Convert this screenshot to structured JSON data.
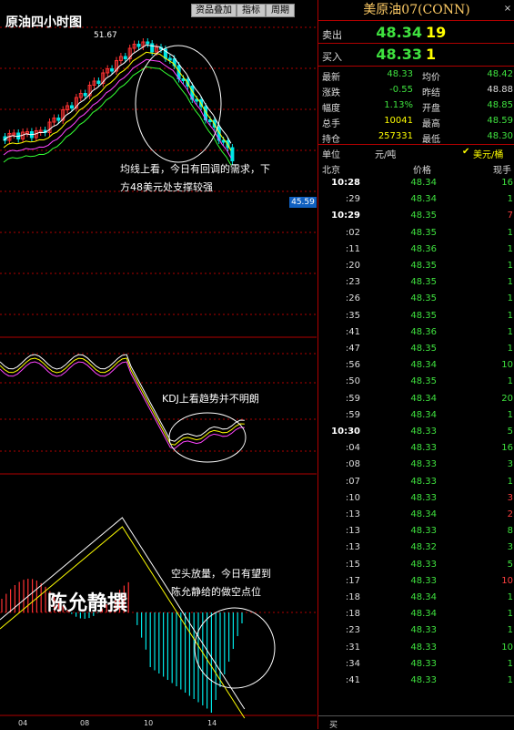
{
  "chart": {
    "title": "原油四小时图",
    "buttons": [
      "资品叠加",
      "指标",
      "周期"
    ],
    "high_label": "51.67",
    "price_tag": "45.59",
    "annot_ma_1": "均线上看，今日有回调的需求，下",
    "annot_ma_2": "方48美元处支撑较强",
    "annot_kdj": "KDJ上看趋势并不明朗",
    "annot_macd_1": "空头放量，今日有望到",
    "annot_macd_2": "陈允静给的做空点位",
    "watermark": "陈允静撰",
    "x_labels": [
      "04",
      "08",
      "10",
      "14"
    ],
    "colors": {
      "up": "#ff3333",
      "down": "#00e6e6",
      "ma1": "#ffffff",
      "ma2": "#ffff00",
      "ma3": "#ff44ff",
      "ma4": "#33ff33"
    }
  },
  "quote": {
    "title": "美原油07(CONN)",
    "close": "×",
    "ask_label": "卖出",
    "ask_price": "48.34",
    "ask_vol": "19",
    "bid_label": "买入",
    "bid_price": "48.33",
    "bid_vol": "1",
    "stats": [
      {
        "l1": "最新",
        "v1": "48.33",
        "c1": "green",
        "l2": "均价",
        "v2": "48.42",
        "c2": "green"
      },
      {
        "l1": "涨跌",
        "v1": "-0.55",
        "c1": "green",
        "l2": "昨结",
        "v2": "48.88",
        "c2": "white"
      },
      {
        "l1": "幅度",
        "v1": "1.13%",
        "c1": "green",
        "l2": "开盘",
        "v2": "48.85",
        "c2": "green"
      },
      {
        "l1": "总手",
        "v1": "10041",
        "c1": "yellow",
        "l2": "最高",
        "v2": "48.59",
        "c2": "green"
      },
      {
        "l1": "持仓",
        "v1": "257331",
        "c1": "yellow",
        "l2": "最低",
        "v2": "48.30",
        "c2": "green"
      }
    ],
    "unit_label": "单位",
    "unit_value": "元/吨",
    "unit_check": "美元/桶",
    "col_time": "北京",
    "col_price": "价格",
    "col_vol": "现手",
    "ticks": [
      {
        "t": "10:28",
        "p": "48.34",
        "v": "16",
        "vc": "green"
      },
      {
        "t": ":29",
        "p": "48.34",
        "v": "1",
        "vc": "green"
      },
      {
        "t": "10:29",
        "p": "48.35",
        "v": "7",
        "vc": "red"
      },
      {
        "t": ":02",
        "p": "48.35",
        "v": "1",
        "vc": "green"
      },
      {
        "t": ":11",
        "p": "48.36",
        "v": "1",
        "vc": "green"
      },
      {
        "t": ":20",
        "p": "48.35",
        "v": "1",
        "vc": "green"
      },
      {
        "t": ":23",
        "p": "48.35",
        "v": "1",
        "vc": "green"
      },
      {
        "t": ":26",
        "p": "48.35",
        "v": "1",
        "vc": "green"
      },
      {
        "t": ":35",
        "p": "48.35",
        "v": "1",
        "vc": "green"
      },
      {
        "t": ":41",
        "p": "48.36",
        "v": "1",
        "vc": "green"
      },
      {
        "t": ":47",
        "p": "48.35",
        "v": "1",
        "vc": "green"
      },
      {
        "t": ":56",
        "p": "48.34",
        "v": "10",
        "vc": "green"
      },
      {
        "t": ":50",
        "p": "48.35",
        "v": "1",
        "vc": "green"
      },
      {
        "t": ":59",
        "p": "48.34",
        "v": "20",
        "vc": "green"
      },
      {
        "t": ":59",
        "p": "48.34",
        "v": "1",
        "vc": "green"
      },
      {
        "t": "10:30",
        "p": "48.33",
        "v": "5",
        "vc": "green"
      },
      {
        "t": ":04",
        "p": "48.33",
        "v": "16",
        "vc": "green"
      },
      {
        "t": ":08",
        "p": "48.33",
        "v": "3",
        "vc": "green"
      },
      {
        "t": ":07",
        "p": "48.33",
        "v": "1",
        "vc": "green"
      },
      {
        "t": ":10",
        "p": "48.33",
        "v": "3",
        "vc": "red"
      },
      {
        "t": ":13",
        "p": "48.34",
        "v": "2",
        "vc": "red"
      },
      {
        "t": ":13",
        "p": "48.33",
        "v": "8",
        "vc": "green"
      },
      {
        "t": ":13",
        "p": "48.32",
        "v": "3",
        "vc": "green"
      },
      {
        "t": ":15",
        "p": "48.33",
        "v": "5",
        "vc": "green"
      },
      {
        "t": ":17",
        "p": "48.33",
        "v": "10",
        "vc": "red"
      },
      {
        "t": ":18",
        "p": "48.34",
        "v": "1",
        "vc": "green"
      },
      {
        "t": ":18",
        "p": "48.34",
        "v": "1",
        "vc": "green"
      },
      {
        "t": ":23",
        "p": "48.33",
        "v": "1",
        "vc": "green"
      },
      {
        "t": ":31",
        "p": "48.33",
        "v": "10",
        "vc": "green"
      },
      {
        "t": ":34",
        "p": "48.33",
        "v": "1",
        "vc": "green"
      },
      {
        "t": ":41",
        "p": "48.33",
        "v": "1",
        "vc": "green"
      }
    ],
    "bottom_label": "买"
  }
}
